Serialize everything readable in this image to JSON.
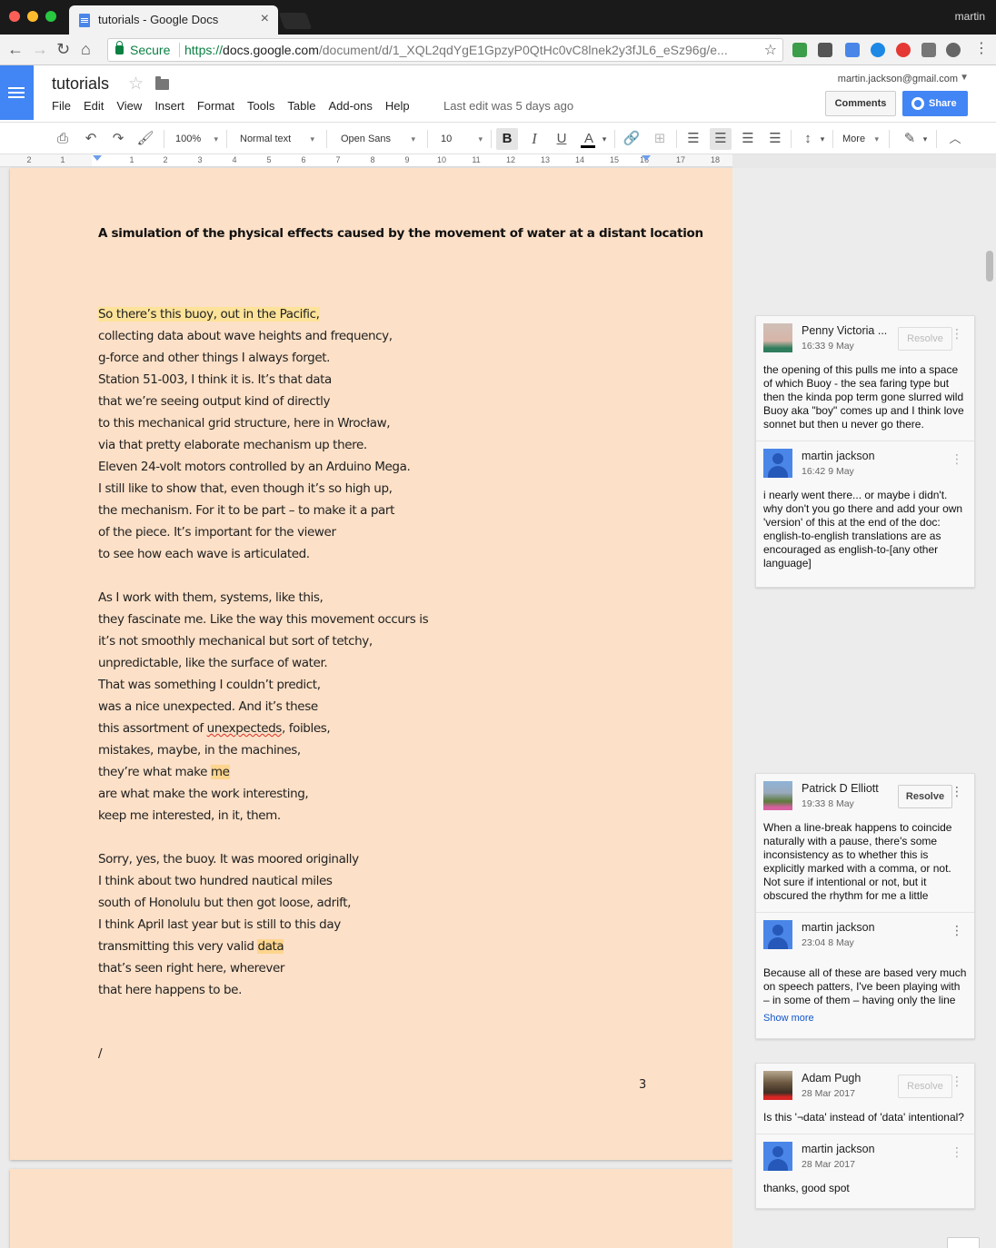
{
  "browser": {
    "tab_title": "tutorials - Google Docs",
    "tab_close": "×",
    "profile_name": "martin",
    "secure_label": "Secure",
    "url_scheme": "https://",
    "url_host": "docs.google.com",
    "url_path": "/document/d/1_XQL2qdYgE1GpzyP0QtHc0vC8lnek2y3fJL6_eSz96g/e..."
  },
  "docs": {
    "title": "tutorials",
    "menu": [
      "File",
      "Edit",
      "View",
      "Insert",
      "Format",
      "Tools",
      "Table",
      "Add-ons",
      "Help"
    ],
    "last_edit": "Last edit was 5 days ago",
    "account_email": "martin.jackson@gmail.com",
    "comments_label": "Comments",
    "share_label": "Share"
  },
  "toolbar": {
    "zoom": "100%",
    "style": "Normal text",
    "font": "Open Sans",
    "size": "10",
    "bold": "B",
    "italic": "I",
    "underline": "U",
    "text_color": "A",
    "more": "More"
  },
  "ruler": {
    "numbers": [
      "2",
      "1",
      "1",
      "2",
      "3",
      "4",
      "5",
      "6",
      "7",
      "8",
      "9",
      "10",
      "11",
      "12",
      "13",
      "14",
      "15",
      "16",
      "17",
      "18"
    ]
  },
  "document": {
    "title": "A simulation of the physical effects caused by the movement of water at a distant location",
    "stanza1": [
      "So there’s this buoy, out in the Pacific,",
      "collecting data about wave heights and frequency,",
      "g-force and other things I always forget.",
      "Station 51-003, I think it is. It’s that data",
      "that we’re seeing output kind of directly",
      "to this mechanical grid structure, here in Wrocław,",
      "via that pretty elaborate mechanism up there.",
      "Eleven 24-volt motors controlled by an Arduino Mega.",
      "I still like to show that, even though it’s so high up,",
      "the mechanism. For it to be part – to make it a part",
      "of the piece. It’s important for the viewer",
      "to see how each wave is articulated."
    ],
    "stanza2": [
      "As I work with them, systems, like this,",
      "they fascinate me. Like the way this movement occurs is",
      "it’s not smoothly mechanical but sort of tetchy,",
      "unpredictable, like the surface of water.",
      "That was something I couldn’t predict,",
      "was a nice unexpected. And it’s these",
      "this assortment of ",
      "unexpecteds",
      ", foibles,",
      "mistakes, maybe, in the machines,",
      "they’re what make ",
      "me",
      "are what make the work interesting,",
      "keep me interested, in it, them."
    ],
    "stanza3": [
      "Sorry, yes, the buoy. It was moored originally",
      "I think about two hundred nautical miles",
      "south of Honolulu but then got loose, adrift,",
      "I think April last year but is still to this day",
      "transmitting this very valid ",
      "data",
      "that’s seen right here, wherever",
      "that here happens to be."
    ],
    "slash": "/",
    "page_number": "3"
  },
  "comments": [
    {
      "entries": [
        {
          "author": "Penny Victoria ...",
          "date": "16:33 9 May",
          "resolve": "Resolve",
          "text": "the opening of this pulls me into a space of which Buoy - the sea faring type but then the kinda pop term gone slurred wild Buoy aka \"boy\" comes up and I think love sonnet but then u never go there."
        },
        {
          "author": "martin jackson",
          "date": "16:42 9 May",
          "text": "i nearly went there... or maybe i didn't. why don't you go there and add your own 'version' of this at the end of the doc: english-to-english translations are as encouraged as english-to-[any other language]"
        }
      ]
    },
    {
      "entries": [
        {
          "author": "Patrick D Elliott",
          "date": "19:33 8 May",
          "resolve": "Resolve",
          "text": "When a line-break happens to coincide naturally with a pause, there's some inconsistency as to whether this is explicitly marked with a comma, or not. Not sure if intentional or not, but it obscured the rhythm for me a little"
        },
        {
          "author": "martin jackson",
          "date": "23:04 8 May",
          "text": "Because all of these are based very much on speech patters, I've been playing with – in some of them – having only the line break represent",
          "more": "Show more"
        }
      ]
    },
    {
      "entries": [
        {
          "author": "Adam Pugh",
          "date": "28 Mar 2017",
          "resolve": "Resolve",
          "text": "Is this '¬data' instead of 'data' intentional?"
        },
        {
          "author": "martin jackson",
          "date": "28 Mar 2017",
          "text": "thanks, good spot"
        }
      ]
    }
  ]
}
